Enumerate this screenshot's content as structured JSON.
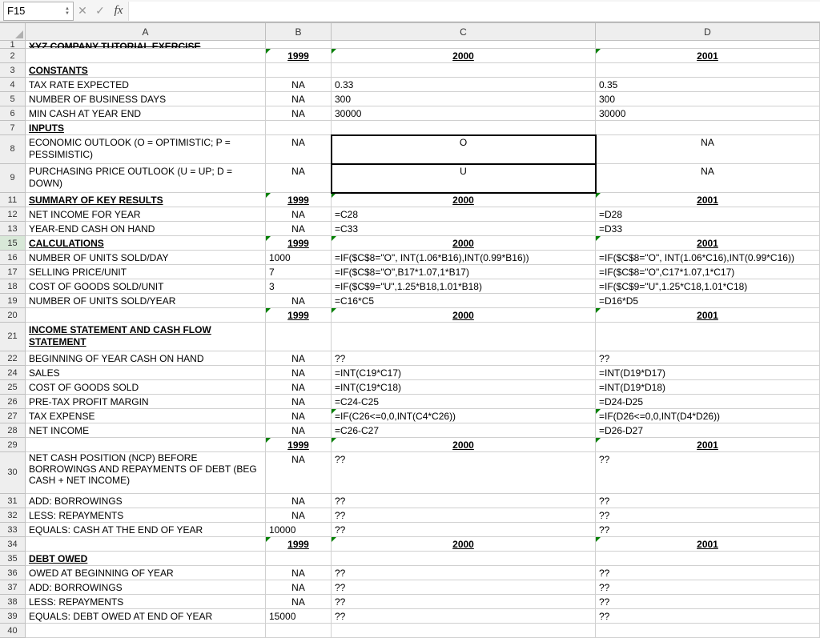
{
  "namebox": "F15",
  "formula": "",
  "col_headers": [
    "A",
    "B",
    "C",
    "D"
  ],
  "rows": [
    {
      "n": "1",
      "h": "",
      "A": "XYZ COMPANY TUTORIAL EXERCISE",
      "Astyle": "bold strike",
      "half": true
    },
    {
      "n": "2",
      "A": "",
      "B": "1999",
      "C": "2000",
      "D": "2001",
      "yearrow": true
    },
    {
      "n": "3",
      "A": "CONSTANTS",
      "Astyle": "bold ul"
    },
    {
      "n": "4",
      "A": "TAX RATE EXPECTED",
      "B": "NA",
      "C": "0.33",
      "D": "0.35"
    },
    {
      "n": "5",
      "A": "NUMBER OF BUSINESS DAYS",
      "B": "NA",
      "C": "300",
      "D": "300"
    },
    {
      "n": "6",
      "A": "MIN CASH AT YEAR END",
      "B": "NA",
      "C": "30000",
      "D": "30000"
    },
    {
      "n": "7",
      "A": "INPUTS",
      "Astyle": "bold ul"
    },
    {
      "n": "8",
      "A": "ECONOMIC OUTLOOK (O = OPTIMISTIC; P = PESSIMISTIC)",
      "B": "NA",
      "C": "O",
      "D": "NA",
      "tall": "tall2",
      "Ccenter": true,
      "Dcenter": true,
      "Bcenter": true,
      "Cbox": true
    },
    {
      "n": "9",
      "A": "PURCHASING PRICE OUTLOOK (U = UP; D = DOWN)",
      "B": "NA",
      "C": "U",
      "D": "NA",
      "tall": "tall2",
      "Ccenter": true,
      "Dcenter": true,
      "Bcenter": true,
      "Cbox": true
    },
    {
      "n": "11",
      "A": "SUMMARY OF KEY RESULTS",
      "Astyle": "bold ul",
      "B": "1999",
      "C": "2000",
      "D": "2001",
      "yearrow": true
    },
    {
      "n": "12",
      "A": "NET INCOME FOR YEAR",
      "B": "NA",
      "C": "=C28",
      "D": "=D28"
    },
    {
      "n": "13",
      "A": "YEAR-END CASH ON HAND",
      "B": "NA",
      "C": "=C33",
      "D": "=D33"
    },
    {
      "n": "15",
      "A": "CALCULATIONS",
      "Astyle": "bold ul",
      "B": "1999",
      "C": "2000",
      "D": "2001",
      "yearrow": true,
      "selrow": true
    },
    {
      "n": "16",
      "A": "NUMBER OF UNITS SOLD/DAY",
      "B": "1000",
      "C": "=IF($C$8=\"O\", INT(1.06*B16),INT(0.99*B16))",
      "D": "=IF($C$8=\"O\", INT(1.06*C16),INT(0.99*C16))",
      "Bleft": true
    },
    {
      "n": "17",
      "A": "SELLING PRICE/UNIT",
      "B": "7",
      "C": "=IF($C$8=\"O\",B17*1.07,1*B17)",
      "D": "=IF($C$8=\"O\",C17*1.07,1*C17)",
      "Bleft": true
    },
    {
      "n": "18",
      "A": "COST OF GOODS SOLD/UNIT",
      "B": "3",
      "C": "=IF($C$9=\"U\",1.25*B18,1.01*B18)",
      "D": "=IF($C$9=\"U\",1.25*C18,1.01*C18)",
      "Bleft": true
    },
    {
      "n": "19",
      "A": "NUMBER OF UNITS SOLD/YEAR",
      "B": "NA",
      "C": "=C16*C5",
      "D": "=D16*D5"
    },
    {
      "n": "20",
      "A": "",
      "B": "1999",
      "C": "2000",
      "D": "2001",
      "yearrow": true
    },
    {
      "n": "21",
      "A": "INCOME STATEMENT AND CASH FLOW STATEMENT",
      "Astyle": "bold ul",
      "tall": "tall2"
    },
    {
      "n": "22",
      "A": "BEGINNING OF YEAR CASH ON HAND",
      "B": "NA",
      "C": "??",
      "D": "??"
    },
    {
      "n": "24",
      "A": "SALES",
      "B": "NA",
      "C": "=INT(C19*C17)",
      "D": "=INT(D19*D17)"
    },
    {
      "n": "25",
      "A": "COST OF GOODS SOLD",
      "B": "NA",
      "C": "=INT(C19*C18)",
      "D": "=INT(D19*D18)"
    },
    {
      "n": "26",
      "A": "PRE-TAX PROFIT MARGIN",
      "B": "NA",
      "C": "=C24-C25",
      "D": "=D24-D25"
    },
    {
      "n": "27",
      "A": "TAX EXPENSE",
      "B": "NA",
      "C": "=IF(C26<=0,0,INT(C4*C26))",
      "D": "=IF(D26<=0,0,INT(D4*D26))",
      "Cflag": true,
      "Dflag": true
    },
    {
      "n": "28",
      "A": "NET INCOME",
      "B": "NA",
      "C": "=C26-C27",
      "D": "=D26-D27"
    },
    {
      "n": "29",
      "A": "",
      "B": "1999",
      "C": "2000",
      "D": "2001",
      "yearrow": true
    },
    {
      "n": "30",
      "A": "NET CASH POSITION (NCP) BEFORE BORROWINGS AND REPAYMENTS OF DEBT (BEG CASH + NET INCOME)",
      "B": "NA",
      "C": "??",
      "D": "??",
      "tall": "tall3",
      "toptrim": true
    },
    {
      "n": "31",
      "A": "ADD: BORROWINGS",
      "B": "NA",
      "C": "??",
      "D": "??"
    },
    {
      "n": "32",
      "A": "LESS: REPAYMENTS",
      "B": "NA",
      "C": "??",
      "D": "??"
    },
    {
      "n": "33",
      "A": "EQUALS: CASH AT THE END OF YEAR",
      "B": "10000",
      "C": "??",
      "D": "??",
      "Bleft": true
    },
    {
      "n": "34",
      "A": "",
      "B": "1999",
      "C": "2000",
      "D": "2001",
      "yearrow": true
    },
    {
      "n": "35",
      "A": "DEBT OWED",
      "Astyle": "bold ul"
    },
    {
      "n": "36",
      "A": "OWED AT BEGINNING OF YEAR",
      "B": "NA",
      "C": "??",
      "D": "??"
    },
    {
      "n": "37",
      "A": "ADD: BORROWINGS",
      "B": "NA",
      "C": "??",
      "D": "??"
    },
    {
      "n": "38",
      "A": "LESS: REPAYMENTS",
      "B": "NA",
      "C": "??",
      "D": "??"
    },
    {
      "n": "39",
      "A": "EQUALS: DEBT OWED AT END OF YEAR",
      "B": "15000",
      "C": "??",
      "D": "??",
      "Bleft": true
    },
    {
      "n": "40",
      "A": ""
    }
  ]
}
